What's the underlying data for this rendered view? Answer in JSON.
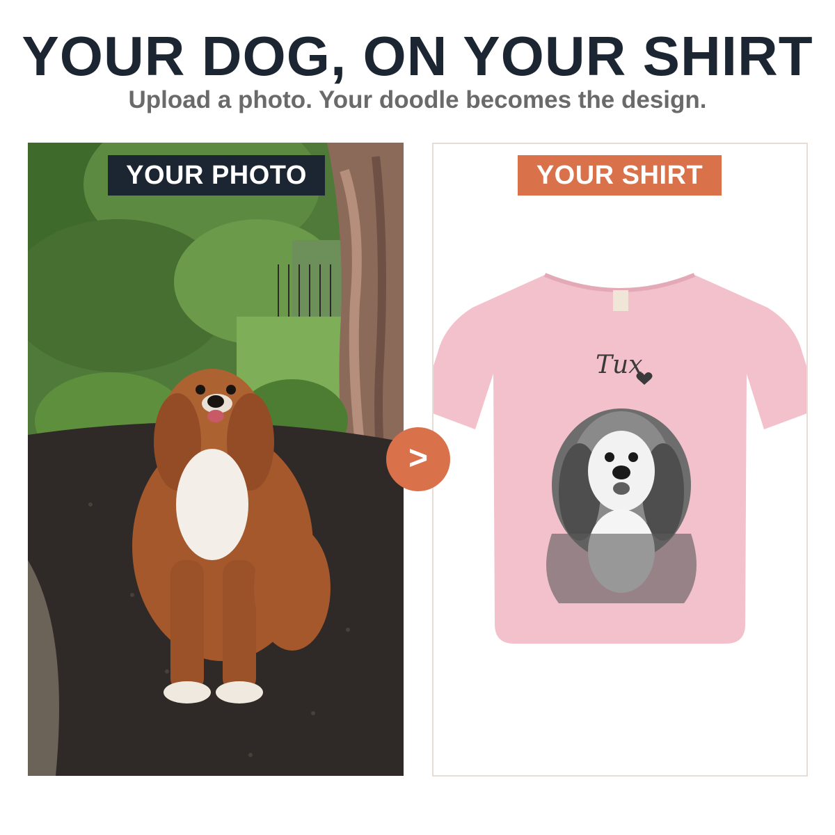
{
  "header": {
    "title": "YOUR DOG, ON YOUR SHIRT",
    "subtitle": "Upload a photo. Your doodle becomes the design."
  },
  "photo_panel": {
    "label": "YOUR PHOTO",
    "label_bg": "#1c2633"
  },
  "shirt_panel": {
    "label": "YOUR SHIRT",
    "label_bg": "#d9714a",
    "shirt_color": "#f3c1cb",
    "print_name": "Tux"
  },
  "arrow": {
    "glyph": ">",
    "color": "#d9714a"
  }
}
